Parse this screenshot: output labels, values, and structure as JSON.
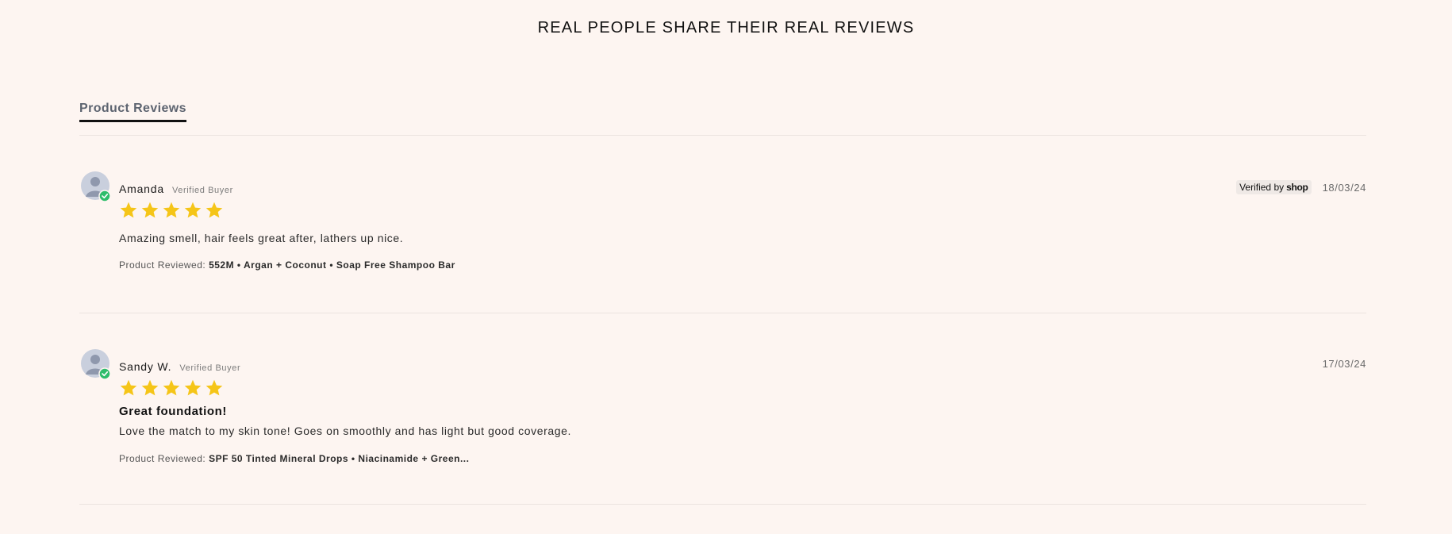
{
  "headline": "REAL PEOPLE SHARE THEIR REAL REVIEWS",
  "tabs": [
    {
      "label": "Product Reviews"
    }
  ],
  "colors": {
    "star": "#f5c518",
    "verified_check": "#2ebd6b",
    "background": "#fdf5f1"
  },
  "reviews": [
    {
      "name": "Amanda",
      "badge": "Verified Buyer",
      "verified_by": "Verified by",
      "verified_brand": "shop",
      "date": "18/03/24",
      "rating": 5,
      "title": "",
      "body": "Amazing smell, hair feels great after, lathers up nice.",
      "product_label": "Product Reviewed:",
      "product_name": "552M • Argan + Coconut • Soap Free Shampoo Bar"
    },
    {
      "name": "Sandy W.",
      "badge": "Verified Buyer",
      "date": "17/03/24",
      "rating": 5,
      "title": "Great foundation!",
      "body": "Love the match to my skin tone! Goes on smoothly and has light but good coverage.",
      "product_label": "Product Reviewed:",
      "product_name": "SPF 50 Tinted Mineral Drops • Niacinamide + Green..."
    }
  ]
}
